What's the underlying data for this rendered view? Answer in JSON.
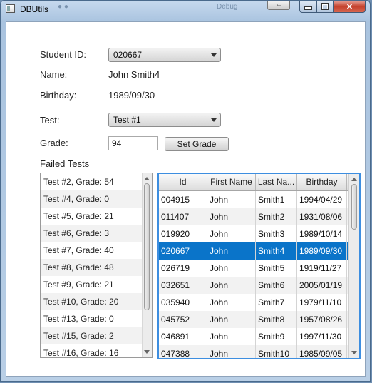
{
  "window": {
    "title": "DBUtils",
    "ghost_text": "Debug",
    "back_label": "←"
  },
  "form": {
    "student_id_label": "Student ID:",
    "student_id_value": "020667",
    "name_label": "Name:",
    "name_value": "John Smith4",
    "birthday_label": "Birthday:",
    "birthday_value": "1989/09/30",
    "test_label": "Test:",
    "test_value": "Test #1",
    "grade_label": "Grade:",
    "grade_value": "94",
    "set_grade_label": "Set Grade",
    "failed_tests_label": "Failed Tests"
  },
  "failed_tests": [
    "Test #2, Grade: 54",
    "Test #4, Grade: 0",
    "Test #5, Grade: 21",
    "Test #6, Grade: 3",
    "Test #7, Grade: 40",
    "Test #8, Grade: 48",
    "Test #9, Grade: 21",
    "Test #10, Grade: 20",
    "Test #13, Grade: 0",
    "Test #15, Grade: 2",
    "Test #16, Grade: 16"
  ],
  "students_table": {
    "headers": [
      "Id",
      "First Name",
      "Last Na...",
      "Birthday"
    ],
    "rows": [
      [
        "004915",
        "John",
        "Smith1",
        "1994/04/29"
      ],
      [
        "011407",
        "John",
        "Smith2",
        "1931/08/06"
      ],
      [
        "019920",
        "John",
        "Smith3",
        "1989/10/14"
      ],
      [
        "020667",
        "John",
        "Smith4",
        "1989/09/30"
      ],
      [
        "026719",
        "John",
        "Smith5",
        "1919/11/27"
      ],
      [
        "032651",
        "John",
        "Smith6",
        "2005/01/19"
      ],
      [
        "035940",
        "John",
        "Smith7",
        "1979/11/10"
      ],
      [
        "045752",
        "John",
        "Smith8",
        "1957/08/26"
      ],
      [
        "046891",
        "John",
        "Smith9",
        "1997/11/30"
      ],
      [
        "047388",
        "John",
        "Smith10",
        "1985/09/05"
      ]
    ],
    "selected_row": 3,
    "selection_color": "#0a74c9",
    "focus_border_color": "#3d8ee0"
  },
  "icons": {
    "app_icon": "window-app-icon",
    "minimize": "minimize-icon",
    "maximize": "maximize-icon",
    "close": "close-icon",
    "dropdown": "chevron-down-icon"
  }
}
